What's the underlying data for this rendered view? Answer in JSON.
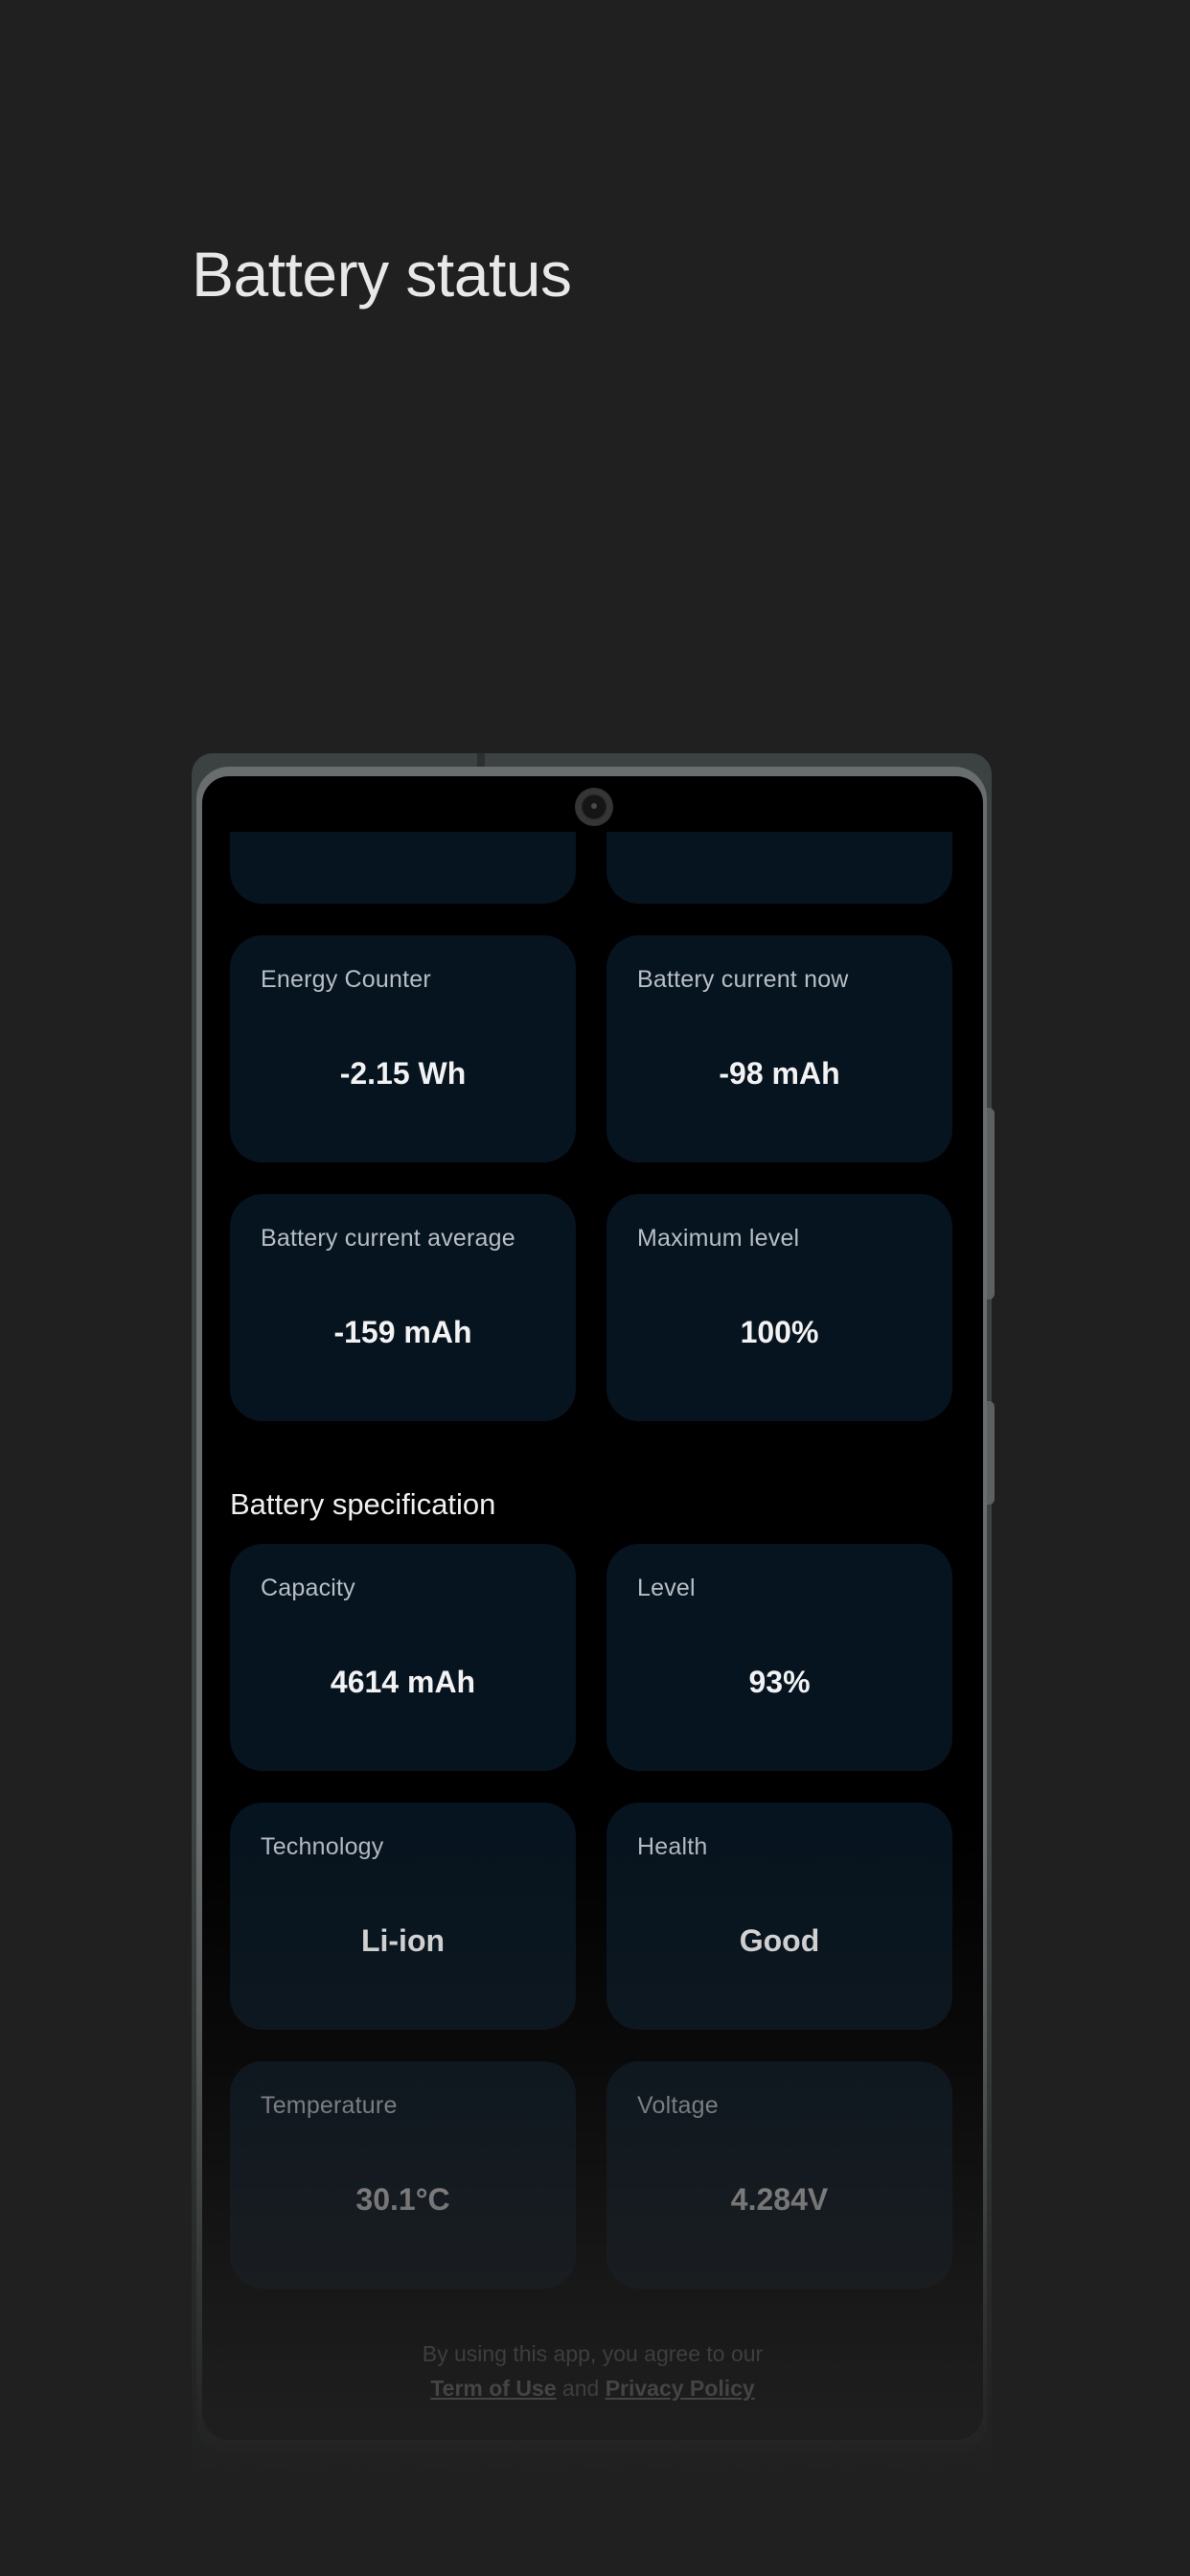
{
  "page": {
    "title": "Battery status"
  },
  "device": {
    "camera_icon": "front-camera-icon"
  },
  "status_cards": [
    {
      "label": "Energy Counter",
      "value": "-2.15 Wh"
    },
    {
      "label": "Battery current now",
      "value": "-98 mAh"
    },
    {
      "label": "Battery current average",
      "value": "-159 mAh"
    },
    {
      "label": "Maximum level",
      "value": "100%"
    }
  ],
  "specification": {
    "title": "Battery specification",
    "cards": [
      {
        "label": "Capacity",
        "value": "4614 mAh"
      },
      {
        "label": "Level",
        "value": "93%"
      },
      {
        "label": "Technology",
        "value": "Li-ion"
      },
      {
        "label": "Health",
        "value": "Good"
      },
      {
        "label": "Temperature",
        "value": "30.1°C"
      },
      {
        "label": "Voltage",
        "value": "4.284V"
      }
    ]
  },
  "footer": {
    "line1": "By using this app, you agree to our",
    "terms_link": "Term of Use",
    "and": "and",
    "privacy_link": "Privacy Policy"
  },
  "colors": {
    "background": "#202020",
    "card": "#06141f",
    "screen": "#000000"
  }
}
